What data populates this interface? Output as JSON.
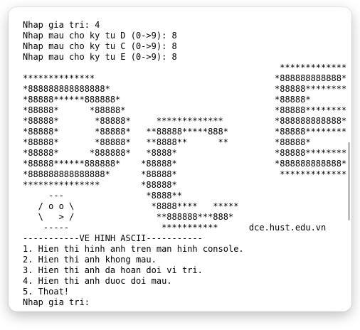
{
  "console": {
    "lines": [
      "Nhap gia tri: 4",
      "Nhap mau cho ky tu D (0->9): 8",
      "Nhap mau cho ky tu C (0->9): 8",
      "Nhap mau cho ky tu E (0->9): 8",
      "                                                  *************",
      "**************                                   *888888888888*",
      "*888888888888888*                                *88888********",
      "*88888******888888*                              *88888*",
      "*88888*      *88888*                             *88888********",
      "*88888*       *88888*     *************          *888888888888*",
      "*88888*       *88888*   **88888*****888*         *88888********",
      "*88888*       *88888*   **8888**      **         *88888*",
      "*88888*      *888888*   *8888*                   *88888********",
      "*88888******888888*    *88888*                   *888888888888*",
      "*888888888888888*      *88888*                    *************",
      "***************        *88888*",
      "     ---                *8888**",
      "   / o o \\               *8888****   *****",
      "   \\   > /                **888888***888*",
      "    -----                  ***********      dce.hust.edu.vn",
      "-----------VE HINH ASCII-----------",
      "1. Hien thi hinh anh tren man hinh console.",
      "2. Hien thi anh khong mau.",
      "3. Hien thi anh da hoan doi vi tri.",
      "4. Hien thi anh duoc doi mau.",
      "5. Thoat!",
      "Nhap gia tri:"
    ]
  }
}
